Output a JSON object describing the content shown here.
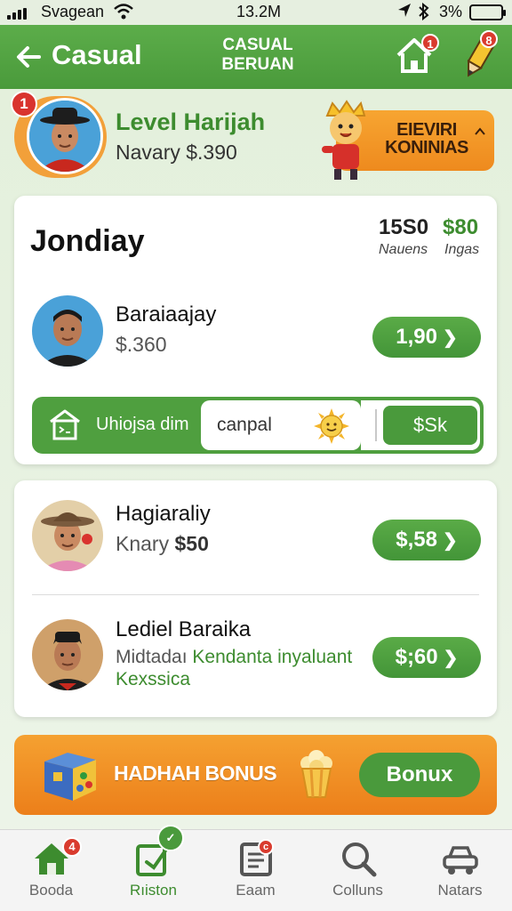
{
  "status_bar": {
    "carrier": "Svagean",
    "time": "13.2M",
    "battery": "3%"
  },
  "header": {
    "title": "Casual",
    "center_line1": "CASUAL",
    "center_line2": "BERUAN",
    "home_badge": "1",
    "pencil_badge": "8"
  },
  "level": {
    "badge": "1",
    "title": "Level Harijah",
    "subtitle": "Navary $.390",
    "promo_line1": "EIEVIRI",
    "promo_line2": "KONINIAS"
  },
  "card_main": {
    "title": "Jondiay",
    "stat1_value": "15S0",
    "stat1_label": "Nauens",
    "stat2_value": "$80",
    "stat2_label": "Ingas",
    "person": {
      "name": "Baraiaajay",
      "sub": "$.360",
      "amount": "1,90"
    },
    "action": {
      "label": "Uhiojsa dim",
      "input_value": "canpal",
      "button": "$Sk"
    }
  },
  "card_list": {
    "items": [
      {
        "name": "Hagiaraliy",
        "sub_prefix": "Knary",
        "sub_amount": "$50",
        "amount": "$,58"
      },
      {
        "name": "Lediel Baraika",
        "sub_prefix": "Midtadaı",
        "sub_green_1": "Kendanta inyaluant",
        "sub_green_2": "Kexssica",
        "amount": "$;60"
      }
    ]
  },
  "bonus": {
    "label": "HADHAH BONUS",
    "button": "Bonux"
  },
  "tabs": [
    {
      "label": "Booda",
      "badge": "4"
    },
    {
      "label": "Rıiston"
    },
    {
      "label": "Eaam",
      "badge": "c"
    },
    {
      "label": "Colluns"
    },
    {
      "label": "Natars"
    }
  ],
  "colors": {
    "brand_green": "#4a9a3b",
    "accent_orange": "#ee8a1e",
    "badge_red": "#d93b2e"
  }
}
